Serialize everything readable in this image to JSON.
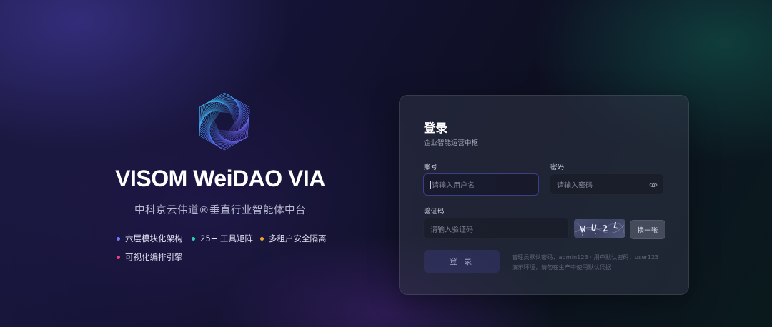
{
  "brand": {
    "title": "VISOM WeiDAO VIA",
    "subtitle": "中科京云伟道®垂直行业智能体中台",
    "logo_icon": "hexagon-spiral-logo"
  },
  "features": [
    {
      "label": "六层模块化架构",
      "dot_color": "#6f78ff"
    },
    {
      "label": "25+ 工具矩阵",
      "dot_color": "#2ad1b0"
    },
    {
      "label": "多租户安全隔离",
      "dot_color": "#f3a52c"
    },
    {
      "label": "可视化编排引擎",
      "dot_color": "#f0427a"
    }
  ],
  "login": {
    "title": "登录",
    "subtitle": "企业智能运营中枢",
    "account_label": "账号",
    "account_placeholder": "请输入用户名",
    "password_label": "密码",
    "password_placeholder": "请输入密码",
    "password_toggle_icon": "eye-icon",
    "captcha_label": "验证码",
    "captcha_placeholder": "请输入验证码",
    "captcha_chars": [
      "W",
      "U",
      "2",
      "L"
    ],
    "refresh_label": "换一张",
    "submit_label": "登 录",
    "hint_line1": "管理员默认密码：admin123 · 用户默认密码：user123",
    "hint_line2": "演示环境，请勿在生产中使用默认凭据"
  }
}
